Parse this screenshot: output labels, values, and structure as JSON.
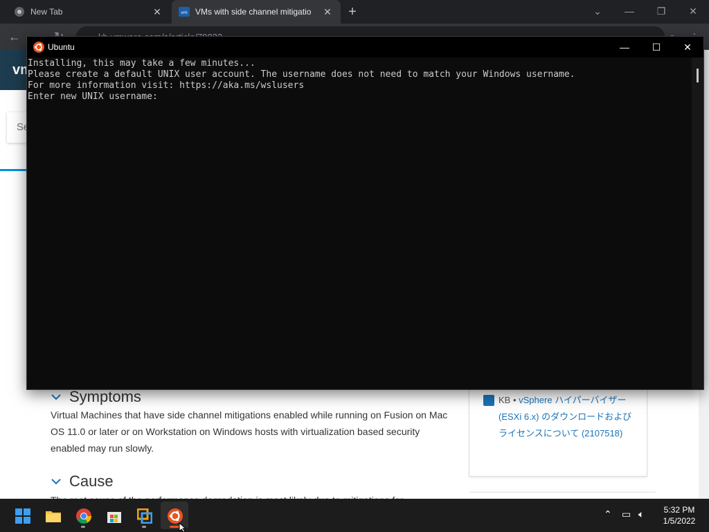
{
  "browser": {
    "tabs": [
      {
        "title": "New Tab"
      },
      {
        "title": "VMs with side channel mitigatio"
      }
    ],
    "url": "kb.vmware.com/s/article/79832"
  },
  "page": {
    "logo": "vm",
    "search_prefix": "Se",
    "symptoms": {
      "heading": "Symptoms",
      "body": "Virtual Machines that have side channel mitigations enabled while running on Fusion on Mac OS 11.0 or later or on Workstation on Windows hosts with virtualization based security enabled may run slowly."
    },
    "cause": {
      "heading": "Cause",
      "body": "The root cause of the performance degradation is most likely due to mitigations for"
    },
    "related": {
      "kb_prefix": "KB •",
      "link_text": "vSphere ハイパーバイザー (ESXi 6.x) のダウンロードおよびライセンスについて (2107518)"
    }
  },
  "terminal": {
    "title": "Ubuntu",
    "lines": [
      "Installing, this may take a few minutes...",
      "Please create a default UNIX user account. The username does not need to match your Windows username.",
      "For more information visit: https://aka.ms/wslusers",
      "Enter new UNIX username: "
    ]
  },
  "taskbar": {
    "apps": [
      "start-icon",
      "file-explorer-icon",
      "chrome-icon",
      "microsoft-store-icon",
      "vmware-icon",
      "ubuntu-icon"
    ],
    "time": "5:32 PM",
    "date": "1/5/2022"
  },
  "colors": {
    "ubuntu_orange": "#e95420",
    "vmware_header": "#1d3c4f",
    "link_blue": "#1a73b8"
  }
}
